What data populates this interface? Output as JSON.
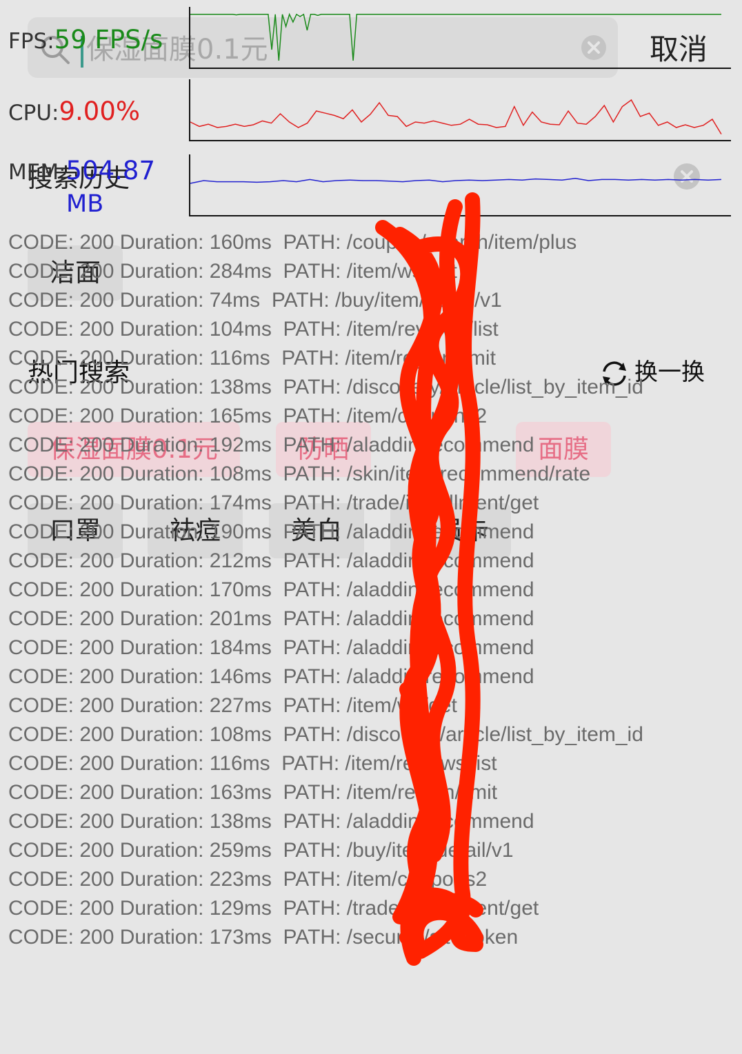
{
  "search": {
    "query": "保湿面膜0.1元",
    "cancel_label": "取消"
  },
  "monitor": {
    "fps": {
      "label": "FPS:",
      "value": "59 FPS/s",
      "color": "#1a8a1a",
      "series": [
        94,
        94,
        94,
        94,
        94,
        94,
        94,
        94,
        94,
        94,
        94,
        94,
        94,
        93,
        94,
        94,
        94,
        94,
        94,
        94,
        94,
        94,
        94,
        30,
        94,
        10,
        94,
        72,
        94,
        80,
        94,
        90,
        94,
        65,
        94,
        94,
        92,
        94,
        94,
        94,
        94,
        94,
        94,
        94,
        94,
        94,
        10,
        94,
        94,
        94,
        94,
        94,
        94,
        94,
        94,
        94,
        94,
        94,
        94,
        94,
        94,
        94,
        94,
        94,
        94,
        94,
        94,
        94,
        94,
        94,
        94,
        94,
        94,
        94,
        94,
        94,
        94,
        94,
        94,
        94,
        94,
        94,
        94,
        94,
        94,
        94,
        94,
        94,
        94,
        94,
        94,
        94,
        94,
        94,
        94,
        94,
        94,
        94,
        94,
        94,
        94,
        94,
        94,
        94,
        94,
        94,
        94,
        94,
        94,
        94,
        94,
        94,
        94,
        94,
        94,
        94,
        94,
        94,
        94,
        94,
        94,
        94,
        94,
        94,
        94,
        94,
        94,
        94,
        94,
        94,
        94,
        94,
        94,
        94,
        94,
        94,
        94,
        94,
        94,
        94,
        94,
        94,
        94,
        94,
        94,
        94,
        94,
        94,
        94,
        94,
        94
      ]
    },
    "cpu": {
      "label": "CPU:",
      "value": "9.00%",
      "color": "#e02020",
      "series": [
        30,
        22,
        26,
        20,
        22,
        26,
        22,
        25,
        32,
        28,
        45,
        30,
        20,
        28,
        50,
        46,
        42,
        36,
        52,
        30,
        44,
        65,
        42,
        40,
        22,
        30,
        28,
        32,
        28,
        24,
        26,
        35,
        26,
        25,
        20,
        22,
        58,
        24,
        48,
        30,
        26,
        25,
        50,
        28,
        26,
        40,
        60,
        30,
        58,
        70,
        40,
        46,
        24,
        30,
        20,
        25,
        20,
        24,
        35,
        8
      ]
    },
    "mem": {
      "label": "MEM:",
      "value": "504.87",
      "unit": "MB",
      "color": "#2020d0",
      "series": [
        55,
        60,
        58,
        58,
        58,
        57,
        58,
        60,
        58,
        62,
        58,
        60,
        61,
        60,
        60,
        59,
        58,
        60,
        61,
        58,
        60,
        61,
        60,
        61,
        62,
        61,
        63,
        62,
        61,
        64,
        60,
        62,
        62,
        61,
        62,
        61,
        62,
        61,
        62,
        61,
        62
      ]
    }
  },
  "history": {
    "title": "搜索历史",
    "items": [
      "洁面"
    ]
  },
  "hot": {
    "title": "热门搜索",
    "refresh_label": "换一换",
    "hot_items": [
      "保湿面膜0.1元",
      "防晒",
      "面膜"
    ],
    "items": [
      "口罩",
      "祛痘",
      "美白",
      "会员卡"
    ]
  },
  "log": [
    "CODE: 200 Duration: 160ms  PATH: /coupon/search/item/plus",
    "CODE: 200 Duration: 284ms  PATH: /item/ws/get",
    "CODE: 200 Duration: 74ms  PATH: /buy/item/detail/v1",
    "CODE: 200 Duration: 104ms  PATH: /item/reviews/list",
    "CODE: 200 Duration: 116ms  PATH: /item/region/limit",
    "CODE: 200 Duration: 138ms  PATH: /discovery/article/list_by_item_id",
    "CODE: 200 Duration: 165ms  PATH: /item/coupons2",
    "CODE: 200 Duration: 192ms  PATH: /aladdin/recommend",
    "CODE: 200 Duration: 108ms  PATH: /skin/item/recommend/rate",
    "CODE: 200 Duration: 174ms  PATH: /trade/installment/get",
    "CODE: 200 Duration: 190ms  PATH: /aladdin/recommend",
    "CODE: 200 Duration: 212ms  PATH: /aladdin/recommend",
    "CODE: 200 Duration: 170ms  PATH: /aladdin/recommend",
    "CODE: 200 Duration: 201ms  PATH: /aladdin/recommend",
    "CODE: 200 Duration: 184ms  PATH: /aladdin/recommend",
    "CODE: 200 Duration: 146ms  PATH: /aladdin/recommend",
    "CODE: 200 Duration: 227ms  PATH: /item/ws/get",
    "CODE: 200 Duration: 108ms  PATH: /discovery/article/list_by_item_id",
    "CODE: 200 Duration: 116ms  PATH: /item/reviews/list",
    "CODE: 200 Duration: 163ms  PATH: /item/region/limit",
    "CODE: 200 Duration: 138ms  PATH: /aladdin/recommend",
    "CODE: 200 Duration: 259ms  PATH: /buy/item/detail/v1",
    "CODE: 200 Duration: 223ms  PATH: /item/coupons2",
    "CODE: 200 Duration: 129ms  PATH: /trade/installment/get",
    "CODE: 200 Duration: 173ms  PATH: /security/site/token"
  ],
  "annotation_color": "#ff2200"
}
